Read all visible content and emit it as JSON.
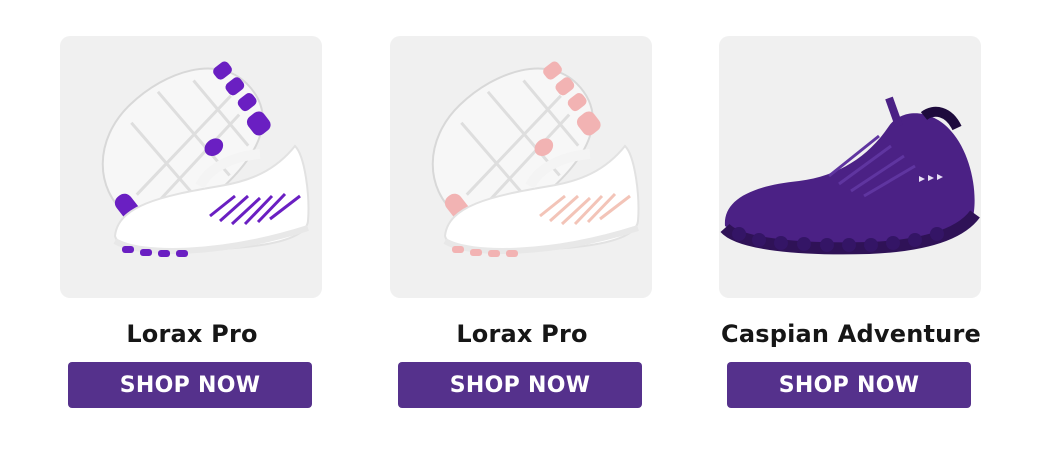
{
  "products": [
    {
      "name": "Lorax Pro",
      "button_label": "SHOP NOW",
      "image_icon": "white-purple-barefoot-shoe-image",
      "accent_color": "#6a1fc2"
    },
    {
      "name": "Lorax Pro",
      "button_label": "SHOP NOW",
      "image_icon": "white-pink-barefoot-shoe-image",
      "accent_color": "#f2b3b3"
    },
    {
      "name": "Caspian Adventure",
      "button_label": "SHOP NOW",
      "image_icon": "purple-barefoot-shoe-image",
      "accent_color": "#4b2185"
    }
  ],
  "colors": {
    "button_bg": "#55318c",
    "button_text": "#ffffff",
    "title_text": "#161616",
    "image_bg": "#f0f0f0"
  }
}
